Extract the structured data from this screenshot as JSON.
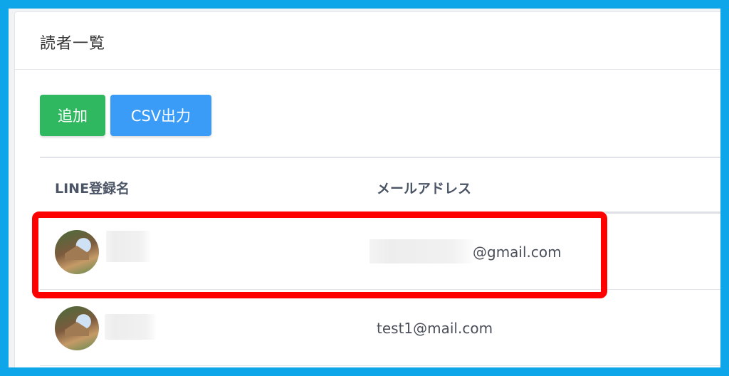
{
  "page": {
    "title": "読者一覧"
  },
  "toolbar": {
    "add_label": "追加",
    "csv_label": "CSV出力"
  },
  "table": {
    "columns": [
      "LINE登録名",
      "メールアドレス"
    ],
    "rows": [
      {
        "name": "",
        "email": "@gmail.com",
        "highlighted": true
      },
      {
        "name": "",
        "email": "test1@mail.com",
        "highlighted": false
      }
    ]
  },
  "colors": {
    "frame": "#0ea5e9",
    "add_button": "#2fb85f",
    "csv_button": "#3b9cf7",
    "highlight": "#ff0000"
  }
}
